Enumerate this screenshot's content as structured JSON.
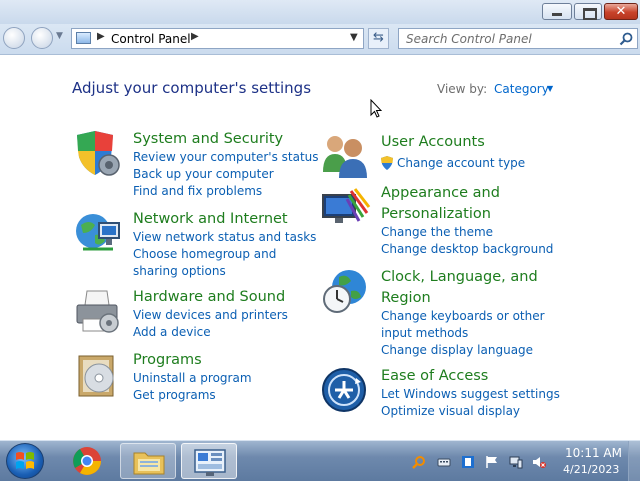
{
  "address": {
    "path": "Control Panel",
    "search_placeholder": "Search Control Panel"
  },
  "content": {
    "title": "Adjust your computer's settings",
    "view_by_label": "View by:",
    "view_by_value": "Category"
  },
  "categories": [
    {
      "title": "System and Security",
      "icon": "shield-icon",
      "links": [
        "Review your computer's status",
        "Back up your computer",
        "Find and fix problems"
      ]
    },
    {
      "title": "Network and Internet",
      "icon": "globe-network-icon",
      "links": [
        "View network status and tasks",
        "Choose homegroup and sharing options"
      ]
    },
    {
      "title": "Hardware and Sound",
      "icon": "printer-icon",
      "links": [
        "View devices and printers",
        "Add a device"
      ]
    },
    {
      "title": "Programs",
      "icon": "programs-disc-icon",
      "links": [
        "Uninstall a program",
        "Get programs"
      ]
    },
    {
      "title": "User Accounts",
      "icon": "users-icon",
      "links": [
        "Change account type"
      ]
    },
    {
      "title": "Appearance and Personalization",
      "icon": "monitor-palette-icon",
      "links": [
        "Change the theme",
        "Change desktop background"
      ]
    },
    {
      "title": "Clock, Language, and Region",
      "icon": "clock-globe-icon",
      "links": [
        "Change keyboards or other input methods",
        "Change display language"
      ]
    },
    {
      "title": "Ease of Access",
      "icon": "ease-of-access-icon",
      "links": [
        "Let Windows suggest settings",
        "Optimize visual display"
      ]
    }
  ],
  "taskbar": {
    "apps": [
      "chrome-icon",
      "explorer-folder-icon",
      "control-panel-icon"
    ],
    "tray": [
      "search-tray-icon",
      "keyboard-tray-icon",
      "tray-app-icon",
      "flag-icon",
      "network-icon",
      "volume-muted-icon"
    ],
    "clock_time": "10:11 AM",
    "clock_date": "4/21/2023"
  },
  "colors": {
    "category_title": "#1e7d1e",
    "link": "#0b5fb3",
    "heading": "#1e3287"
  }
}
